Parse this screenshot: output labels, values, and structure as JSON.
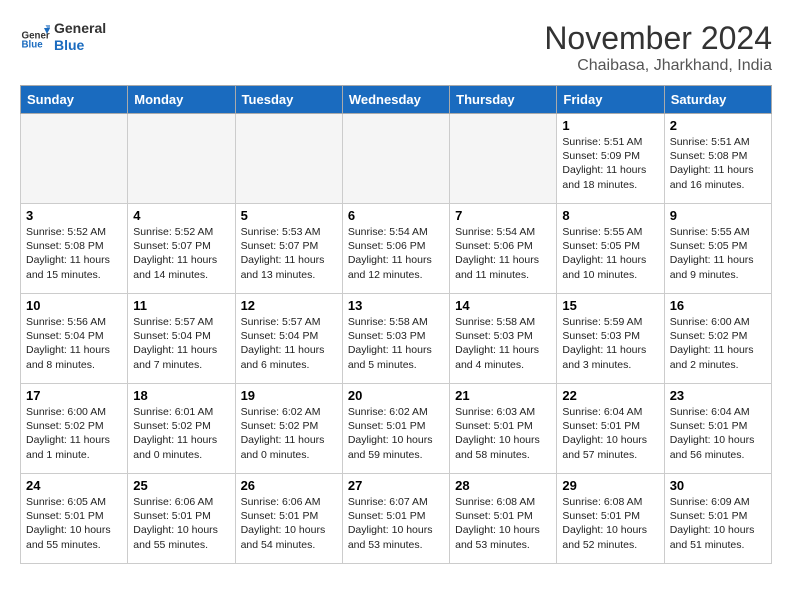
{
  "header": {
    "logo_general": "General",
    "logo_blue": "Blue",
    "month_title": "November 2024",
    "location": "Chaibasa, Jharkhand, India"
  },
  "weekdays": [
    "Sunday",
    "Monday",
    "Tuesday",
    "Wednesday",
    "Thursday",
    "Friday",
    "Saturday"
  ],
  "weeks": [
    [
      {
        "day": "",
        "info": ""
      },
      {
        "day": "",
        "info": ""
      },
      {
        "day": "",
        "info": ""
      },
      {
        "day": "",
        "info": ""
      },
      {
        "day": "",
        "info": ""
      },
      {
        "day": "1",
        "info": "Sunrise: 5:51 AM\nSunset: 5:09 PM\nDaylight: 11 hours\nand 18 minutes."
      },
      {
        "day": "2",
        "info": "Sunrise: 5:51 AM\nSunset: 5:08 PM\nDaylight: 11 hours\nand 16 minutes."
      }
    ],
    [
      {
        "day": "3",
        "info": "Sunrise: 5:52 AM\nSunset: 5:08 PM\nDaylight: 11 hours\nand 15 minutes."
      },
      {
        "day": "4",
        "info": "Sunrise: 5:52 AM\nSunset: 5:07 PM\nDaylight: 11 hours\nand 14 minutes."
      },
      {
        "day": "5",
        "info": "Sunrise: 5:53 AM\nSunset: 5:07 PM\nDaylight: 11 hours\nand 13 minutes."
      },
      {
        "day": "6",
        "info": "Sunrise: 5:54 AM\nSunset: 5:06 PM\nDaylight: 11 hours\nand 12 minutes."
      },
      {
        "day": "7",
        "info": "Sunrise: 5:54 AM\nSunset: 5:06 PM\nDaylight: 11 hours\nand 11 minutes."
      },
      {
        "day": "8",
        "info": "Sunrise: 5:55 AM\nSunset: 5:05 PM\nDaylight: 11 hours\nand 10 minutes."
      },
      {
        "day": "9",
        "info": "Sunrise: 5:55 AM\nSunset: 5:05 PM\nDaylight: 11 hours\nand 9 minutes."
      }
    ],
    [
      {
        "day": "10",
        "info": "Sunrise: 5:56 AM\nSunset: 5:04 PM\nDaylight: 11 hours\nand 8 minutes."
      },
      {
        "day": "11",
        "info": "Sunrise: 5:57 AM\nSunset: 5:04 PM\nDaylight: 11 hours\nand 7 minutes."
      },
      {
        "day": "12",
        "info": "Sunrise: 5:57 AM\nSunset: 5:04 PM\nDaylight: 11 hours\nand 6 minutes."
      },
      {
        "day": "13",
        "info": "Sunrise: 5:58 AM\nSunset: 5:03 PM\nDaylight: 11 hours\nand 5 minutes."
      },
      {
        "day": "14",
        "info": "Sunrise: 5:58 AM\nSunset: 5:03 PM\nDaylight: 11 hours\nand 4 minutes."
      },
      {
        "day": "15",
        "info": "Sunrise: 5:59 AM\nSunset: 5:03 PM\nDaylight: 11 hours\nand 3 minutes."
      },
      {
        "day": "16",
        "info": "Sunrise: 6:00 AM\nSunset: 5:02 PM\nDaylight: 11 hours\nand 2 minutes."
      }
    ],
    [
      {
        "day": "17",
        "info": "Sunrise: 6:00 AM\nSunset: 5:02 PM\nDaylight: 11 hours\nand 1 minute."
      },
      {
        "day": "18",
        "info": "Sunrise: 6:01 AM\nSunset: 5:02 PM\nDaylight: 11 hours\nand 0 minutes."
      },
      {
        "day": "19",
        "info": "Sunrise: 6:02 AM\nSunset: 5:02 PM\nDaylight: 11 hours\nand 0 minutes."
      },
      {
        "day": "20",
        "info": "Sunrise: 6:02 AM\nSunset: 5:01 PM\nDaylight: 10 hours\nand 59 minutes."
      },
      {
        "day": "21",
        "info": "Sunrise: 6:03 AM\nSunset: 5:01 PM\nDaylight: 10 hours\nand 58 minutes."
      },
      {
        "day": "22",
        "info": "Sunrise: 6:04 AM\nSunset: 5:01 PM\nDaylight: 10 hours\nand 57 minutes."
      },
      {
        "day": "23",
        "info": "Sunrise: 6:04 AM\nSunset: 5:01 PM\nDaylight: 10 hours\nand 56 minutes."
      }
    ],
    [
      {
        "day": "24",
        "info": "Sunrise: 6:05 AM\nSunset: 5:01 PM\nDaylight: 10 hours\nand 55 minutes."
      },
      {
        "day": "25",
        "info": "Sunrise: 6:06 AM\nSunset: 5:01 PM\nDaylight: 10 hours\nand 55 minutes."
      },
      {
        "day": "26",
        "info": "Sunrise: 6:06 AM\nSunset: 5:01 PM\nDaylight: 10 hours\nand 54 minutes."
      },
      {
        "day": "27",
        "info": "Sunrise: 6:07 AM\nSunset: 5:01 PM\nDaylight: 10 hours\nand 53 minutes."
      },
      {
        "day": "28",
        "info": "Sunrise: 6:08 AM\nSunset: 5:01 PM\nDaylight: 10 hours\nand 53 minutes."
      },
      {
        "day": "29",
        "info": "Sunrise: 6:08 AM\nSunset: 5:01 PM\nDaylight: 10 hours\nand 52 minutes."
      },
      {
        "day": "30",
        "info": "Sunrise: 6:09 AM\nSunset: 5:01 PM\nDaylight: 10 hours\nand 51 minutes."
      }
    ]
  ]
}
